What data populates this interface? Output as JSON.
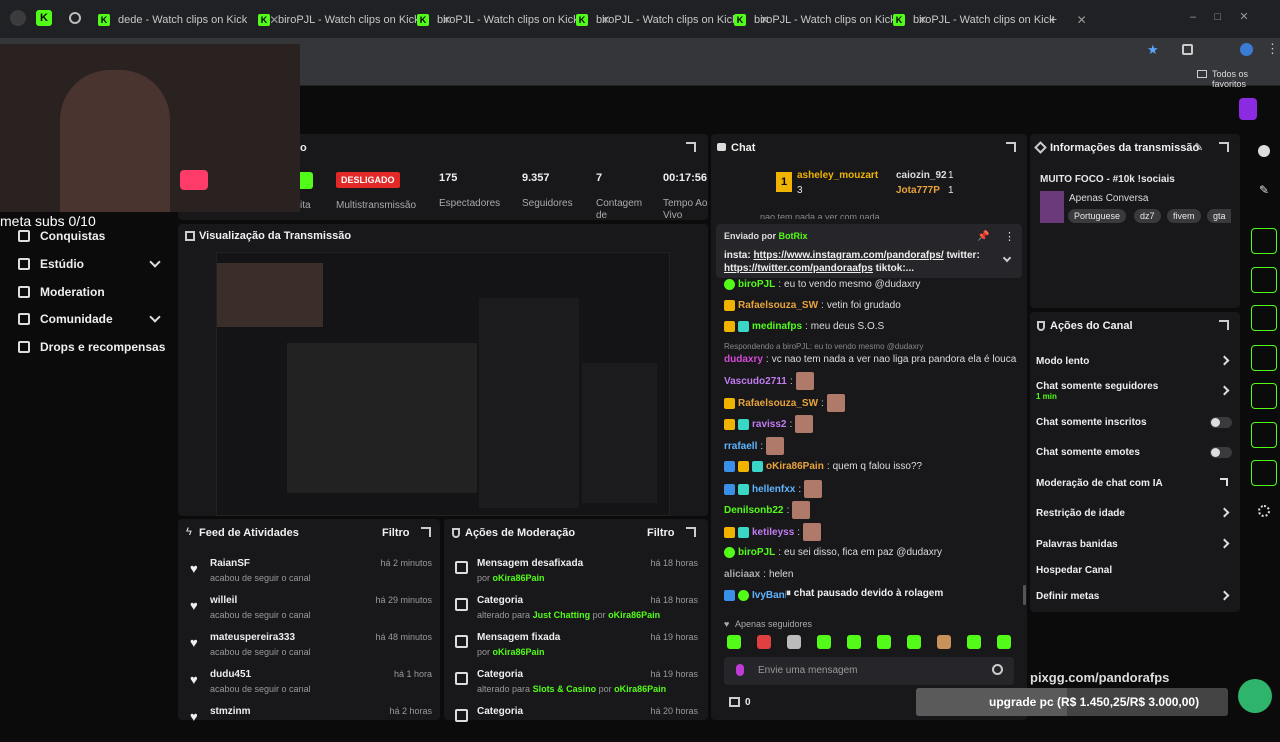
{
  "browser": {
    "tabs": [
      {
        "label": "dede - Watch clips on Kick"
      },
      {
        "label": "biroPJL - Watch clips on Kick"
      },
      {
        "label": "biroPJL - Watch clips on Kick"
      },
      {
        "label": "biroPJL - Watch clips on Kick"
      },
      {
        "label": "biroPJL - Watch clips on Kick"
      },
      {
        "label": "biroPJL - Watch clips on Kick"
      }
    ],
    "bookmarks_label": "Todos os favoritos"
  },
  "webcam": {
    "overlay_text": "meta subs 0/10"
  },
  "sidebar": {
    "items": [
      {
        "label": "Conquistas"
      },
      {
        "label": "Estúdio"
      },
      {
        "label": "Moderation"
      },
      {
        "label": "Comunidade"
      },
      {
        "label": "Drops e recompensas"
      }
    ]
  },
  "stream_header": {
    "title_fragment": "o",
    "status_badge": "DESLIGADO",
    "multistream_label": "Multistransmissão",
    "cut_label_1": "ita",
    "stats": [
      {
        "value": "175",
        "label": "Espectadores"
      },
      {
        "value": "9.357",
        "label": "Seguidores"
      },
      {
        "value": "7",
        "label": "Contagem de"
      },
      {
        "value": "00:17:56",
        "label": "Tempo Ao Vivo"
      }
    ]
  },
  "preview": {
    "title": "Visualização da Transmissão"
  },
  "feed": {
    "title": "Feed de Atividades",
    "filter": "Filtro",
    "rows": [
      {
        "name": "RaianSF",
        "desc": "acabou de seguir o canal",
        "time": "há 2 minutos"
      },
      {
        "name": "willeil",
        "desc": "acabou de seguir o canal",
        "time": "há 29 minutos"
      },
      {
        "name": "mateuspereira333",
        "desc": "acabou de seguir o canal",
        "time": "há 48 minutos"
      },
      {
        "name": "dudu451",
        "desc": "acabou de seguir o canal",
        "time": "há 1 hora"
      },
      {
        "name": "stmzinm",
        "desc": "",
        "time": "há 2 horas"
      }
    ]
  },
  "mod_actions": {
    "title": "Ações de Moderação",
    "filter": "Filtro",
    "rows": [
      {
        "name": "Mensagem desafixada",
        "pre": "por",
        "hl": "oKira86Pain",
        "mid": "",
        "hl2": "",
        "time": "há 18 horas"
      },
      {
        "name": "Categoria",
        "pre": "alterado para",
        "hl": "Just Chatting",
        "mid": "por",
        "hl2": "oKira86Pain",
        "time": "há 18 horas"
      },
      {
        "name": "Mensagem fixada",
        "pre": "por",
        "hl": "oKira86Pain",
        "mid": "",
        "hl2": "",
        "time": "há 19 horas"
      },
      {
        "name": "Categoria",
        "pre": "alterado para",
        "hl": "Slots & Casino",
        "mid": "por",
        "hl2": "oKira86Pain",
        "time": "há 19 horas"
      },
      {
        "name": "Categoria",
        "pre": "",
        "hl": "",
        "mid": "",
        "hl2": "",
        "time": "há 20 horas"
      }
    ]
  },
  "chat": {
    "title": "Chat",
    "top_gifters": [
      {
        "name": "asheley_mouzart",
        "count": "3"
      },
      {
        "name": "caiozin_92",
        "count": "1"
      },
      {
        "name": "Jota777P",
        "count": "1"
      }
    ],
    "cut_message": "nao tem nada a ver com nada",
    "pinned": {
      "sent_by_label": "Enviado por",
      "sender": "BotRix",
      "text_1": "insta: ",
      "link_1": "https://www.instagram.com/pandorafps/",
      "text_2": " twitter:",
      "link_2": "https://twitter.com/pandoraafps",
      "text_3": " tiktok:..."
    },
    "messages": [
      {
        "user": "biroPJL",
        "text": "eu to vendo mesmo @dudaxry",
        "color": "#53fc18"
      },
      {
        "user": "Rafaelsouza_SW",
        "text": "vetin foi grudado",
        "color": "#e8a33a"
      },
      {
        "user": "medinafps",
        "text": "meu deus S.O.S",
        "color": "#53fc18"
      },
      {
        "user": "dudaxry",
        "text": "vc nao tem nada a ver nao liga pra pandora ela é louca",
        "color": "#d64ad6"
      },
      {
        "user": "Vascudo2711",
        "text": "",
        "color": "#c27cf2"
      },
      {
        "user": "Rafaelsouza_SW",
        "text": "",
        "color": "#e8a33a"
      },
      {
        "user": "raviss2",
        "text": "",
        "color": "#c27cf2"
      },
      {
        "user": "rrafaell",
        "text": "",
        "color": "#5fb4ff"
      },
      {
        "user": "oKira86Pain",
        "text": "quem q falou isso??",
        "color": "#e8a33a"
      },
      {
        "user": "hellenfxx",
        "text": "",
        "color": "#5fb4ff"
      },
      {
        "user": "Denilsonb22",
        "text": "",
        "color": "#53fc18"
      },
      {
        "user": "ketileyss",
        "text": "",
        "color": "#c27cf2"
      },
      {
        "user": "biroPJL",
        "text": "eu sei disso, fica em paz @dudaxry",
        "color": "#53fc18"
      },
      {
        "user": "aliciaax",
        "text": "helen",
        "color": "#aaa"
      },
      {
        "user": "IvyBani",
        "text": "",
        "color": "#5fb4ff"
      }
    ],
    "reply_label": "Respondendo a biroPJL: eu to vendo mesmo @dudaxry",
    "paused_label": "chat pausado devido à rolagem",
    "mode_label": "Apenas seguidores",
    "input_placeholder": "Envie uma mensagem",
    "bottom_count": "0"
  },
  "stream_info": {
    "title": "Informações da transmissão",
    "stream_title": "MUITO FOCO - #10k !sociais",
    "category": "Apenas Conversa",
    "tags": [
      "Portuguese",
      "dz7",
      "fivem",
      "gta"
    ]
  },
  "channel_actions": {
    "title": "Ações do Canal",
    "items": [
      {
        "label": "Modo lento",
        "sub": "",
        "kind": "arrow"
      },
      {
        "label": "Chat somente seguidores",
        "sub": "1 min",
        "kind": "arrow"
      },
      {
        "label": "Chat somente inscritos",
        "sub": "",
        "kind": "toggle"
      },
      {
        "label": "Chat somente emotes",
        "sub": "",
        "kind": "toggle"
      },
      {
        "label": "Moderação de chat com IA",
        "sub": "",
        "kind": "external"
      },
      {
        "label": "Restrição de idade",
        "sub": "",
        "kind": "arrow"
      },
      {
        "label": "Palavras banidas",
        "sub": "",
        "kind": "arrow"
      },
      {
        "label": "Hospedar Canal",
        "sub": "",
        "kind": "none"
      },
      {
        "label": "Definir metas",
        "sub": "",
        "kind": "arrow"
      }
    ]
  },
  "overlay": {
    "pix_text": "pixgg.com/pandorafps",
    "goal_text": "upgrade pc (R$ 1.450,25/R$ 3.000,00)"
  },
  "colors": {
    "accent": "#53fc18",
    "status_red": "#e32828",
    "panel": "#18181b"
  }
}
